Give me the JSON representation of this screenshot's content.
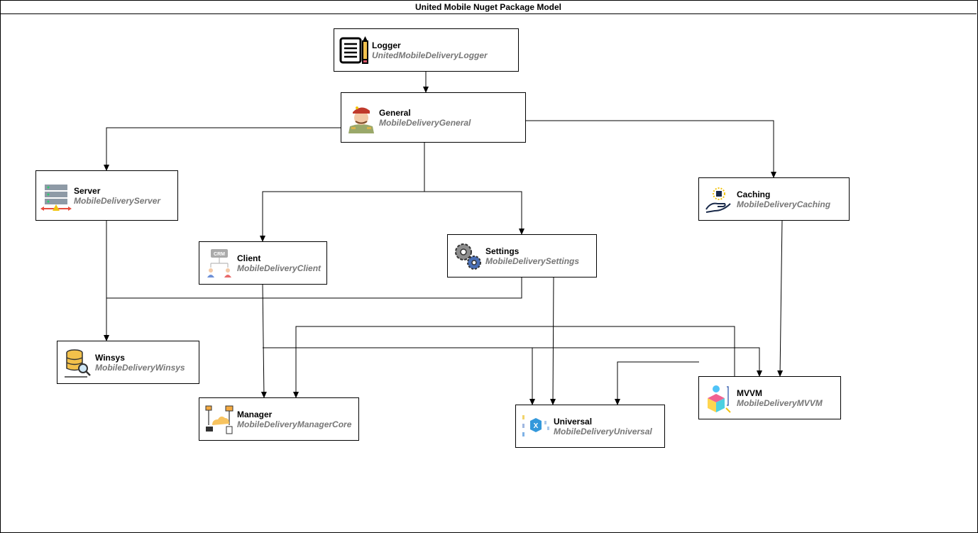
{
  "diagram": {
    "title": "United Mobile Nuget Package Model",
    "nodes": [
      {
        "id": "logger",
        "name": "Logger",
        "package": "UnitedMobileDeliveryLogger",
        "icon": "notepad-pencil-icon"
      },
      {
        "id": "general",
        "name": "General",
        "package": "MobileDeliveryGeneral",
        "icon": "general-soldier-icon"
      },
      {
        "id": "server",
        "name": "Server",
        "package": "MobileDeliveryServer",
        "icon": "server-rack-icon"
      },
      {
        "id": "caching",
        "name": "Caching",
        "package": "MobileDeliveryCaching",
        "icon": "hand-chip-icon"
      },
      {
        "id": "client",
        "name": "Client",
        "package": "MobileDeliveryClient",
        "icon": "crm-users-icon"
      },
      {
        "id": "settings",
        "name": "Settings",
        "package": "MobileDeliverySettings",
        "icon": "gears-icon"
      },
      {
        "id": "winsys",
        "name": "Winsys",
        "package": "MobileDeliveryWinsys",
        "icon": "database-search-icon"
      },
      {
        "id": "manager",
        "name": "Manager",
        "package": "MobileDeliveryManagerCore",
        "icon": "cloud-network-icon"
      },
      {
        "id": "universal",
        "name": "Universal",
        "package": "MobileDeliveryUniversal",
        "icon": "xamarin-icon"
      },
      {
        "id": "mvvm",
        "name": "MVVM",
        "package": "MobileDeliveryMVVM",
        "icon": "blocks-icon"
      }
    ],
    "edges": [
      {
        "from": "logger",
        "to": "general"
      },
      {
        "from": "general",
        "to": "server"
      },
      {
        "from": "general",
        "to": "client"
      },
      {
        "from": "general",
        "to": "settings"
      },
      {
        "from": "general",
        "to": "caching"
      },
      {
        "from": "server",
        "to": "winsys"
      },
      {
        "from": "settings",
        "to": "winsys"
      },
      {
        "from": "client",
        "to": "manager"
      },
      {
        "from": "client",
        "to": "universal"
      },
      {
        "from": "client",
        "to": "mvvm"
      },
      {
        "from": "settings",
        "to": "universal"
      },
      {
        "from": "mvvm",
        "to": "manager"
      },
      {
        "from": "mvvm",
        "to": "universal"
      },
      {
        "from": "caching",
        "to": "mvvm"
      }
    ]
  }
}
